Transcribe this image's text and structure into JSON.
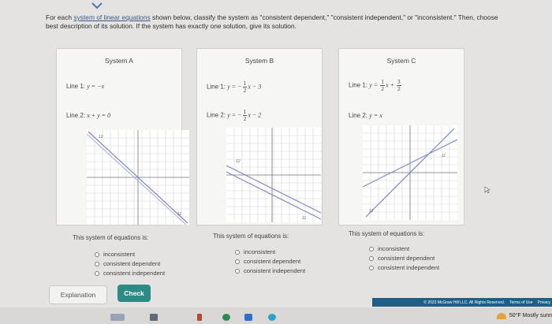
{
  "instructions": {
    "pre": "For each ",
    "link": "system of linear equations",
    "post": " shown below, classify the system as \"consistent dependent,\" \"consistent independent,\" or \"inconsistent.\" Then, choose",
    "line2": "best description of its solution. If the system has exactly one solution, give its solution."
  },
  "systems": [
    {
      "title": "System A",
      "line1_label": "Line 1: ",
      "line1_eq": "y = −x",
      "line2_label": "Line 2: ",
      "line2_eq": "x + y = 0",
      "graph_labels": {
        "tl": "12",
        "br": "11"
      },
      "question": "This system of equations is:",
      "options": [
        "inconsistent",
        "consistent dependent",
        "consistent independent"
      ]
    },
    {
      "title": "System B",
      "line1_label": "Line 1: ",
      "line1_pre": "y = −",
      "line1_frac": {
        "num": "1",
        "den": "2"
      },
      "line1_post": "x − 3",
      "line2_label": "Line 2: ",
      "line2_pre": "y = −",
      "line2_frac": {
        "num": "1",
        "den": "2"
      },
      "line2_post": "x − 2",
      "graph_labels": {
        "tl": "12",
        "br": "11"
      },
      "question": "This system of equations is:",
      "options": [
        "inconsistent",
        "consistent dependent",
        "consistent independent"
      ]
    },
    {
      "title": "System C",
      "line1_label": "Line 1: ",
      "line1_pre": "y = ",
      "line1_frac": {
        "num": "1",
        "den": "2"
      },
      "line1_mid": "x + ",
      "line1_frac2": {
        "num": "3",
        "den": "2"
      },
      "line2_label": "Line 2: ",
      "line2_eq": "y = x",
      "graph_labels": {
        "bl": "12",
        "tr": "11"
      },
      "question": "This system of equations is:",
      "options": [
        "inconsistent",
        "consistent dependent",
        "consistent independent"
      ]
    }
  ],
  "buttons": {
    "explanation": "Explanation",
    "check": "Check"
  },
  "footer": {
    "copyright": "© 2023 McGraw Hill LLC. All Rights Reserved.",
    "terms": "Terms of Use",
    "privacy": "Privacy"
  },
  "weather": {
    "text": "50°F  Mostly sunn"
  },
  "colors": {
    "accent": "#2d8b86",
    "line_blue": "#7b86c8",
    "footer_bg": "#1f5f86"
  }
}
